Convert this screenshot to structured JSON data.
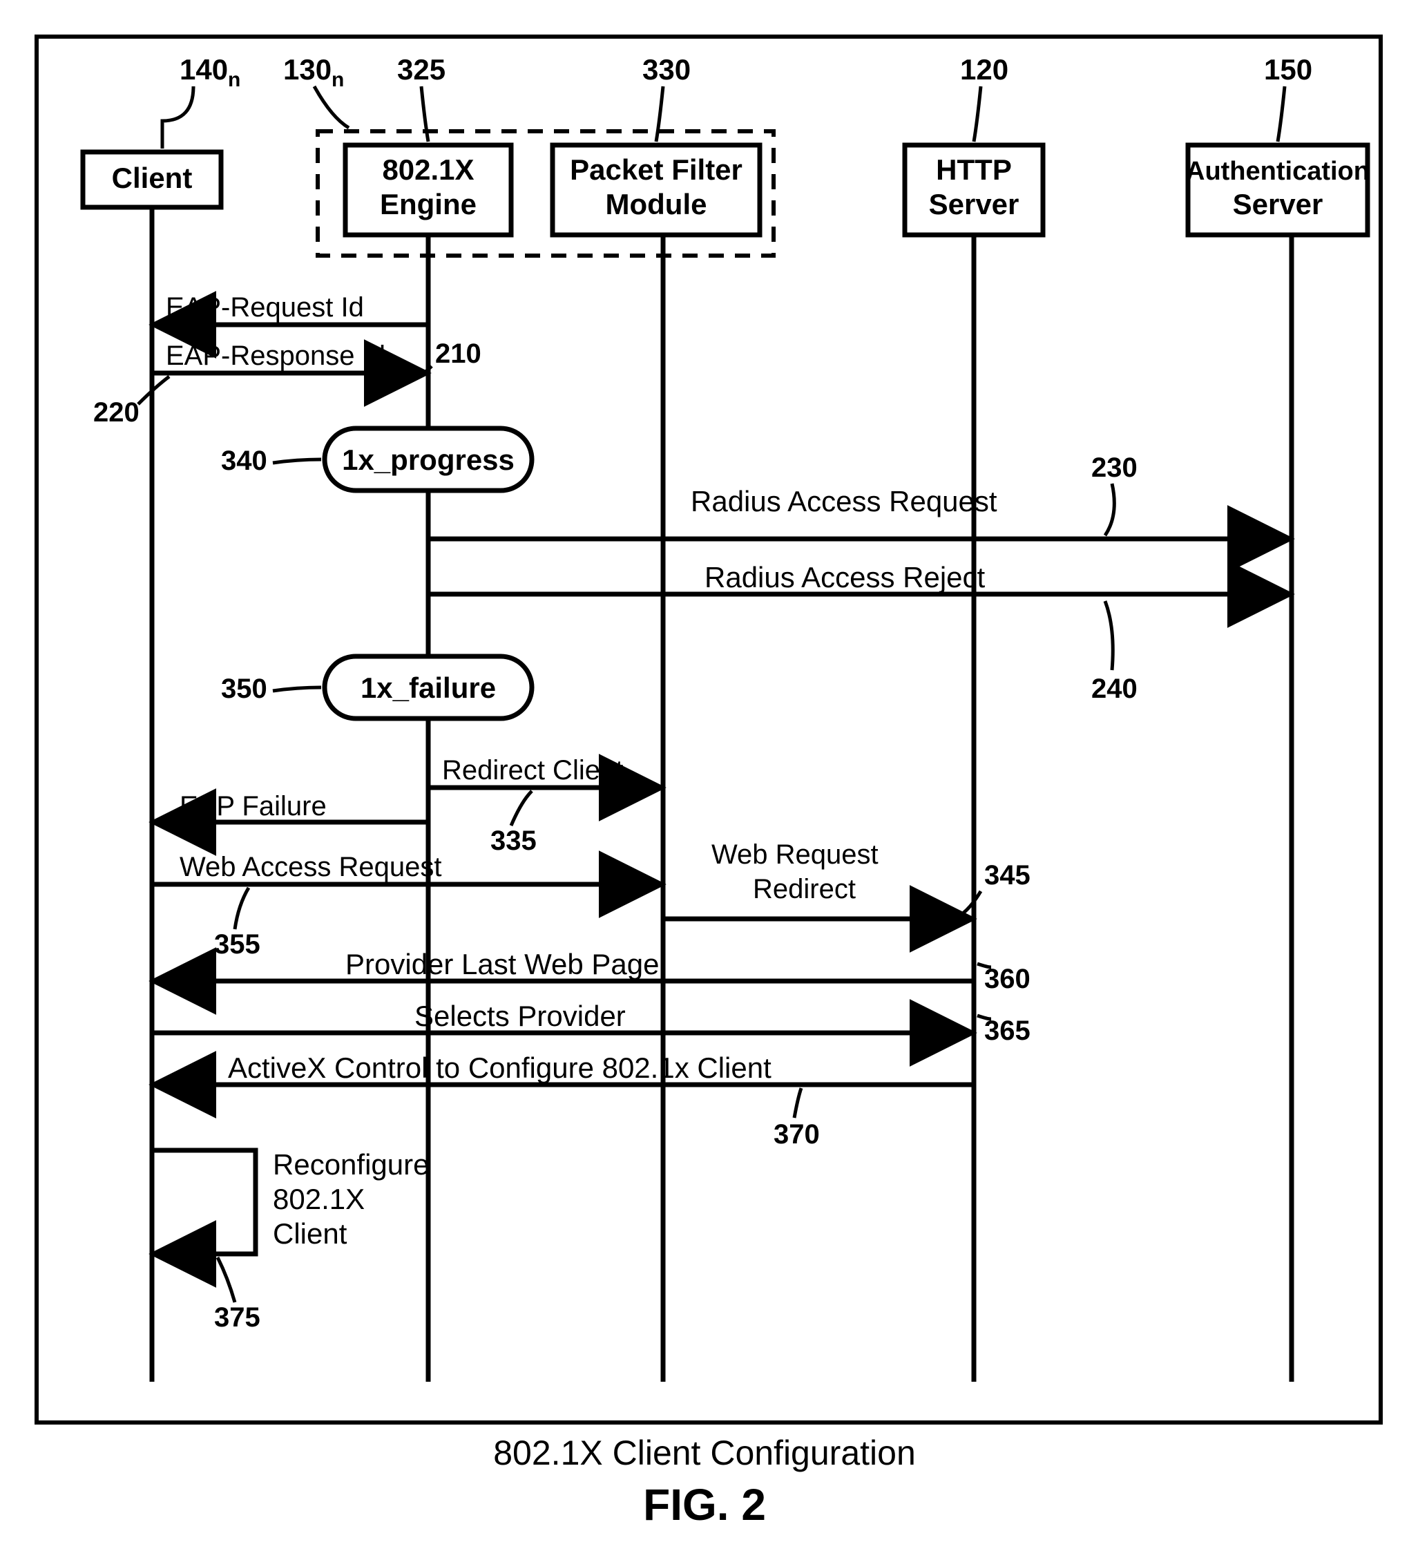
{
  "participants": {
    "client": {
      "label_top": "140",
      "sub": "n",
      "box": "Client"
    },
    "engine": {
      "label_top": "130",
      "sub": "n",
      "box": "802.1X\nEngine",
      "ref_325": "325"
    },
    "filter": {
      "label_top": "330",
      "box": "Packet Filter\nModule"
    },
    "http": {
      "label_top": "120",
      "box": "HTTP\nServer"
    },
    "auth": {
      "label_top": "150",
      "box": "Authentication\nServer"
    }
  },
  "messages": {
    "eap_req": {
      "text": "EAP-Request Id",
      "ref": "210"
    },
    "eap_resp": {
      "text": "EAP-Response Id",
      "ref": "220"
    },
    "state_progress": {
      "text": "1x_progress",
      "ref": "340"
    },
    "radius_req": {
      "text": "Radius Access Request",
      "ref": "230"
    },
    "radius_rej": {
      "text": "Radius Access Reject",
      "ref": "240"
    },
    "state_failure": {
      "text": "1x_failure",
      "ref": "350"
    },
    "redirect_client": {
      "text": "Redirect Client",
      "ref": "335"
    },
    "eap_failure": {
      "text": "EAP Failure"
    },
    "web_access": {
      "text": "Web Access Request",
      "ref": "355"
    },
    "web_redirect": {
      "text": "Web Request\nRedirect",
      "ref": "345"
    },
    "provider_last": {
      "text": "Provider Last Web Page",
      "ref": "360"
    },
    "selects": {
      "text": "Selects Provider",
      "ref": "365"
    },
    "activex": {
      "text": "ActiveX Control to Configure 802.1x Client",
      "ref": "370"
    },
    "reconfigure": {
      "text": "Reconfigure\n802.1X\nClient",
      "ref": "375"
    }
  },
  "caption": "802.1X Client Configuration",
  "figure": "FIG. 2",
  "chart_data": {
    "type": "sequence-diagram",
    "participants": [
      "Client",
      "802.1X Engine",
      "Packet Filter Module",
      "HTTP Server",
      "Authentication Server"
    ],
    "group": {
      "label": "130_n",
      "members": [
        "802.1X Engine",
        "Packet Filter Module"
      ]
    },
    "refs": {
      "Client": "140_n",
      "802.1X Engine": "325",
      "Packet Filter Module": "330",
      "HTTP Server": "120",
      "Authentication Server": "150"
    },
    "events": [
      {
        "from": "802.1X Engine",
        "to": "Client",
        "label": "EAP-Request Id",
        "ref": "210"
      },
      {
        "from": "Client",
        "to": "802.1X Engine",
        "label": "EAP-Response Id",
        "ref": "220"
      },
      {
        "state": "1x_progress",
        "at": "802.1X Engine",
        "ref": "340"
      },
      {
        "from": "802.1X Engine",
        "to": "Authentication Server",
        "label": "Radius Access Request",
        "ref": "230"
      },
      {
        "from": "Authentication Server",
        "to": "802.1X Engine",
        "label": "Radius Access Reject",
        "ref": "240"
      },
      {
        "state": "1x_failure",
        "at": "802.1X Engine",
        "ref": "350"
      },
      {
        "from": "802.1X Engine",
        "to": "Packet Filter Module",
        "label": "Redirect Client",
        "ref": "335"
      },
      {
        "from": "802.1X Engine",
        "to": "Client",
        "label": "EAP Failure"
      },
      {
        "from": "Client",
        "to": "Packet Filter Module",
        "label": "Web Access Request",
        "ref": "355"
      },
      {
        "from": "Packet Filter Module",
        "to": "HTTP Server",
        "label": "Web Request Redirect",
        "ref": "345"
      },
      {
        "from": "HTTP Server",
        "to": "Client",
        "label": "Provider Last Web Page",
        "ref": "360"
      },
      {
        "from": "Client",
        "to": "HTTP Server",
        "label": "Selects Provider",
        "ref": "365"
      },
      {
        "from": "HTTP Server",
        "to": "Client",
        "label": "ActiveX Control to Configure 802.1x Client",
        "ref": "370"
      },
      {
        "self": "Client",
        "label": "Reconfigure 802.1X Client",
        "ref": "375"
      }
    ]
  }
}
